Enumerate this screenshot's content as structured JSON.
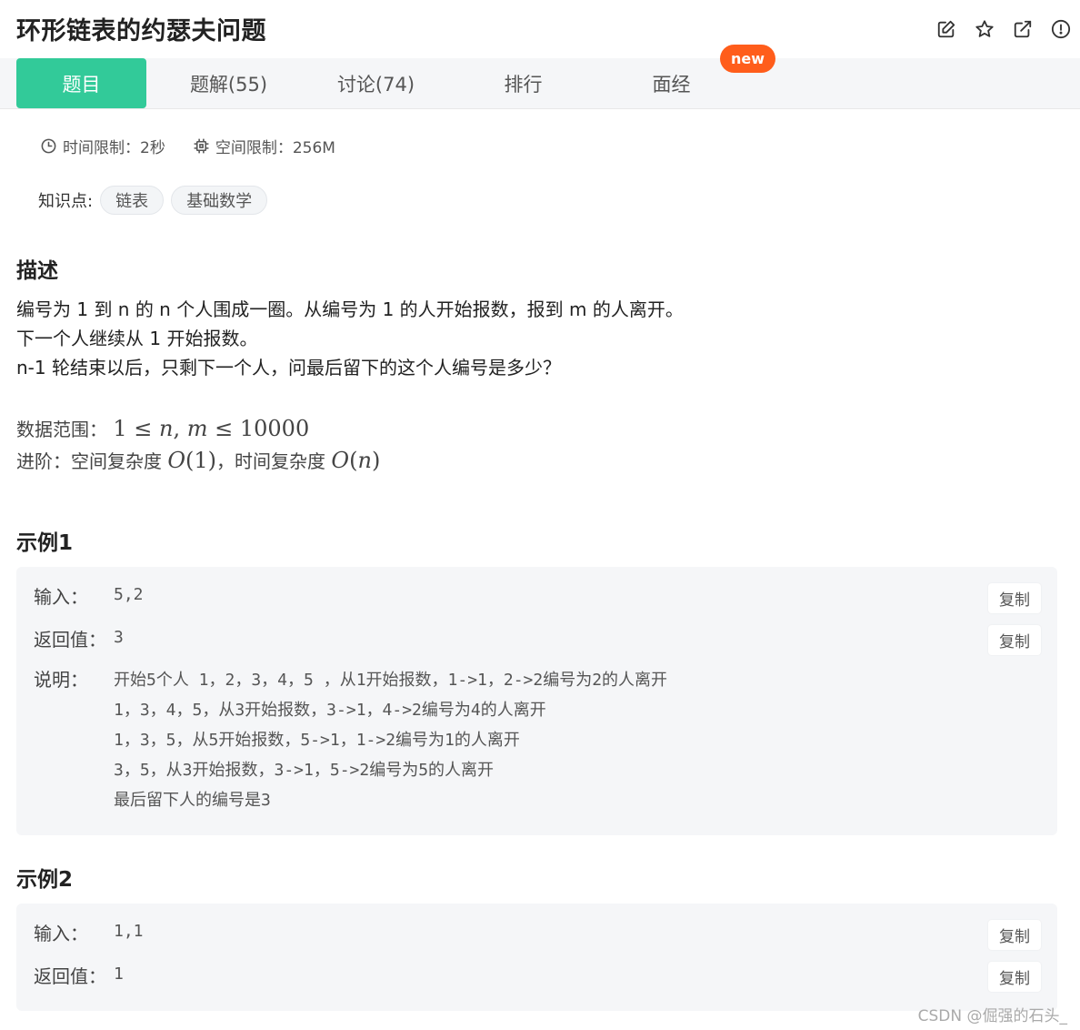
{
  "header": {
    "title": "环形链表的约瑟夫问题",
    "icons": [
      "edit-icon",
      "star-icon",
      "external-link-icon",
      "report-icon"
    ]
  },
  "tabs": [
    {
      "label": "题目",
      "active": true
    },
    {
      "label": "题解(55)",
      "active": false
    },
    {
      "label": "讨论(74)",
      "active": false
    },
    {
      "label": "排行",
      "active": false
    },
    {
      "label": "面经",
      "active": false
    }
  ],
  "new_badge": "new",
  "limits": {
    "time": "时间限制：2秒",
    "memory": "空间限制：256M"
  },
  "knowledge": {
    "label": "知识点:",
    "tags": [
      "链表",
      "基础数学"
    ]
  },
  "description": {
    "title": "描述",
    "lines": [
      "编号为 1 到 n 的 n 个人围成一圈。从编号为 1 的人开始报数，报到 m 的人离开。",
      "下一个人继续从 1 开始报数。",
      "n-1 轮结束以后，只剩下一个人，问最后留下的这个人编号是多少？"
    ],
    "range_label": "数据范围：",
    "advanced_label": "进阶：空间复杂度",
    "advanced_mid": "，时间复杂度"
  },
  "examples": [
    {
      "title": "示例1",
      "input_label": "输入：",
      "input": "5,2",
      "output_label": "返回值：",
      "output": "3",
      "explain_label": "说明：",
      "explain": [
        "开始5个人 1，2，3，4，5 ，从1开始报数，1->1，2->2编号为2的人离开",
        "1，3，4，5，从3开始报数，3->1，4->2编号为4的人离开",
        "1，3，5，从5开始报数，5->1，1->2编号为1的人离开",
        "3，5，从3开始报数，3->1，5->2编号为5的人离开",
        "最后留下人的编号是3"
      ],
      "copy_label": "复制"
    },
    {
      "title": "示例2",
      "input_label": "输入：",
      "input": "1,1",
      "output_label": "返回值：",
      "output": "1",
      "copy_label": "复制"
    }
  ],
  "watermark": "CSDN @倔强的石头_",
  "colors": {
    "accent": "#32ca99",
    "badge": "#ff5d1b",
    "box_bg": "#f5f6f8"
  }
}
